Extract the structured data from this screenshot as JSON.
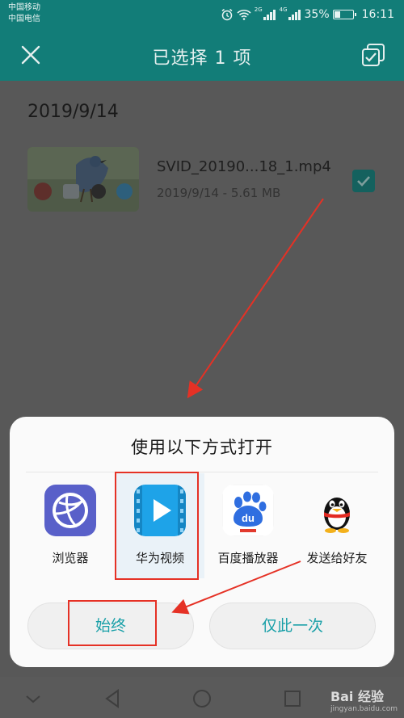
{
  "status_bar": {
    "carrier_1": "中国移动",
    "carrier_2": "中国电信",
    "sim1_tag": "2G",
    "sim2_tag": "4G",
    "battery_percent": "35%",
    "battery_level": 0.35,
    "time": "16:11"
  },
  "title_bar": {
    "title": "已选择 1 项",
    "close_icon": "close-icon",
    "select_all_icon": "select-all-icon"
  },
  "file_list": {
    "date": "2019/9/14",
    "file": {
      "name": "SVID_20190...18_1.mp4",
      "meta": "2019/9/14 - 5.61 MB",
      "checked": true
    }
  },
  "open_with": {
    "title": "使用以下方式打开",
    "apps": [
      {
        "label": "浏览器",
        "icon": "browser-icon"
      },
      {
        "label": "华为视频",
        "icon": "huawei-video-icon",
        "selected": true
      },
      {
        "label": "百度播放器",
        "icon": "baidu-player-icon"
      },
      {
        "label": "发送给好友",
        "icon": "qq-icon"
      }
    ],
    "always_label": "始终",
    "just_once_label": "仅此一次"
  },
  "nav_bar": {
    "icons": [
      "collapse-icon",
      "back-icon",
      "home-icon",
      "recents-icon"
    ]
  },
  "colors": {
    "teal": "#127d78",
    "accent": "#1aa0a8",
    "annotation_red": "#e53125"
  },
  "watermark": {
    "brand": "Bai 经验",
    "url": "jingyan.baidu.com"
  }
}
